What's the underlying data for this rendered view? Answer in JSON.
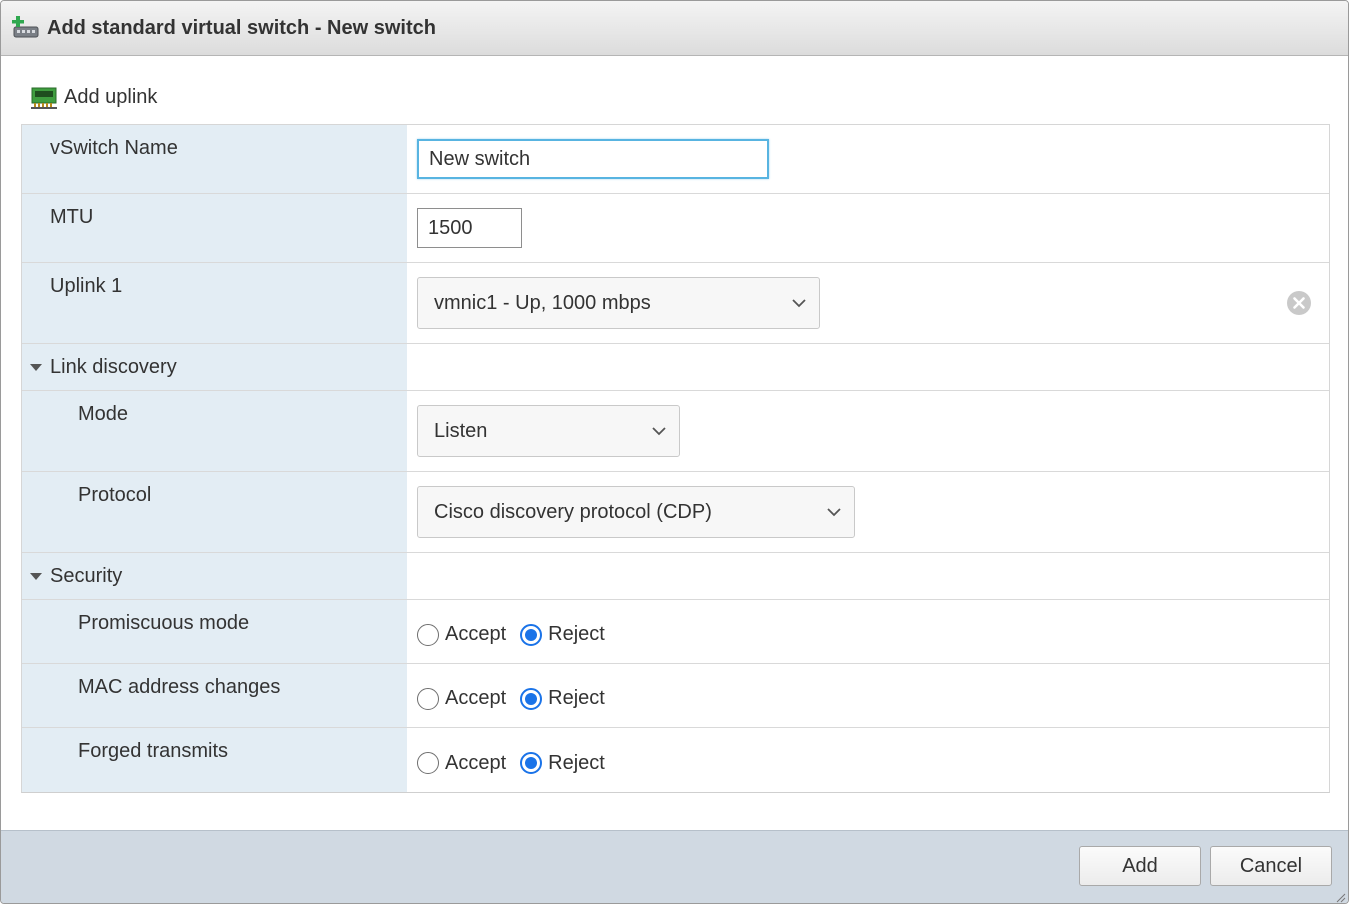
{
  "dialog": {
    "title": "Add standard virtual switch - New switch",
    "title_icon": "vswitch-add-icon"
  },
  "toolbar": {
    "add_uplink_label": "Add uplink",
    "add_uplink_icon": "nic-card-icon"
  },
  "form": {
    "vswitch_name": {
      "label": "vSwitch Name",
      "value": "New switch"
    },
    "mtu": {
      "label": "MTU",
      "value": "1500"
    },
    "uplink1": {
      "label": "Uplink 1",
      "value": "vmnic1 - Up, 1000 mbps"
    },
    "link_discovery": {
      "label": "Link discovery",
      "mode": {
        "label": "Mode",
        "value": "Listen"
      },
      "protocol": {
        "label": "Protocol",
        "value": "Cisco discovery protocol (CDP)"
      }
    },
    "security": {
      "label": "Security",
      "accept_label": "Accept",
      "reject_label": "Reject",
      "promiscuous": {
        "label": "Promiscuous mode",
        "selected": "Reject"
      },
      "mac_changes": {
        "label": "MAC address changes",
        "selected": "Reject"
      },
      "forged": {
        "label": "Forged transmits",
        "selected": "Reject"
      }
    }
  },
  "footer": {
    "add_label": "Add",
    "cancel_label": "Cancel"
  },
  "colors": {
    "label_column_bg": "#e3edf4",
    "focus_border": "#58b4e1",
    "radio_selected": "#1a73e8",
    "footer_bg": "#d0d9e2"
  }
}
